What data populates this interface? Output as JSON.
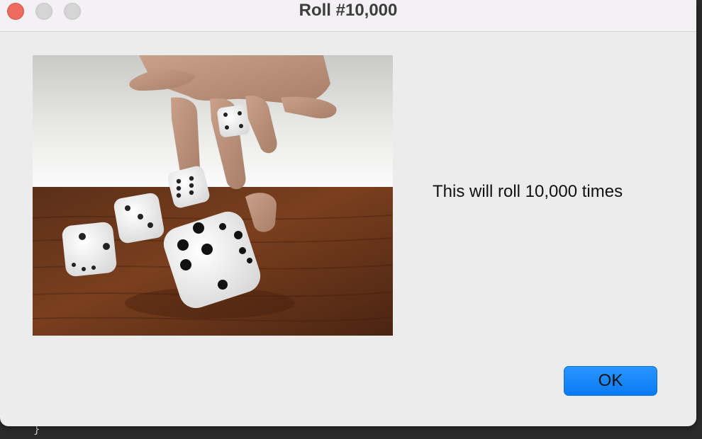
{
  "window": {
    "title": "Roll #10,000"
  },
  "dialog": {
    "message": "This will roll 10,000 times",
    "ok_label": "OK",
    "image_icon": "dice-photo"
  },
  "colors": {
    "accent": "#0a7bf5",
    "close": "#ec6a5e",
    "inactive_traffic": "#d6d5d6",
    "dialog_bg": "#ececec"
  }
}
